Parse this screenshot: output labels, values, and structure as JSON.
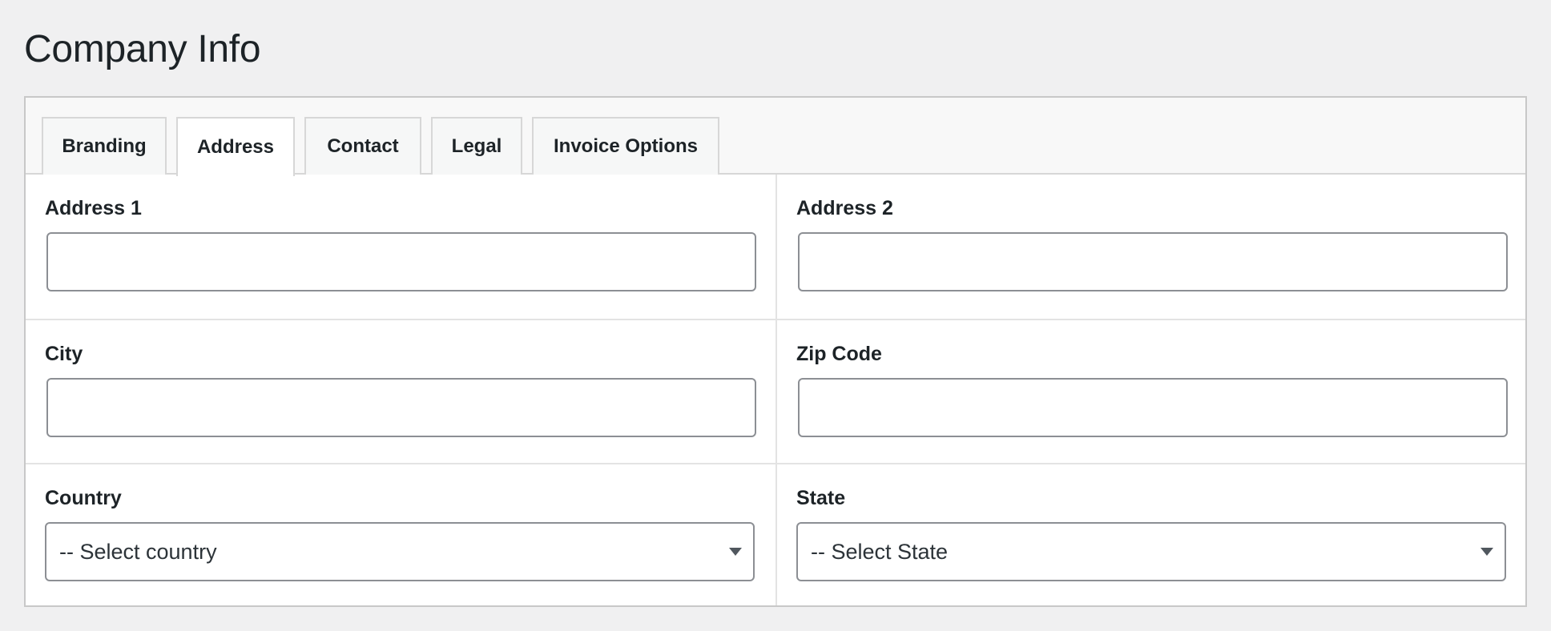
{
  "page": {
    "title": "Company Info"
  },
  "tabs": [
    {
      "label": "Branding",
      "active": false
    },
    {
      "label": "Address",
      "active": true
    },
    {
      "label": "Contact",
      "active": false
    },
    {
      "label": "Legal",
      "active": false
    },
    {
      "label": "Invoice Options",
      "active": false
    }
  ],
  "fields": {
    "address1": {
      "label": "Address 1",
      "value": "",
      "placeholder": ""
    },
    "address2": {
      "label": "Address 2",
      "value": "",
      "placeholder": ""
    },
    "city": {
      "label": "City",
      "value": "",
      "placeholder": ""
    },
    "zip": {
      "label": "Zip Code",
      "value": "",
      "placeholder": ""
    },
    "country": {
      "label": "Country",
      "selected": "-- Select country"
    },
    "state": {
      "label": "State",
      "selected": "-- Select State"
    }
  },
  "icons": {
    "select_arrow": "caret-down-icon"
  }
}
